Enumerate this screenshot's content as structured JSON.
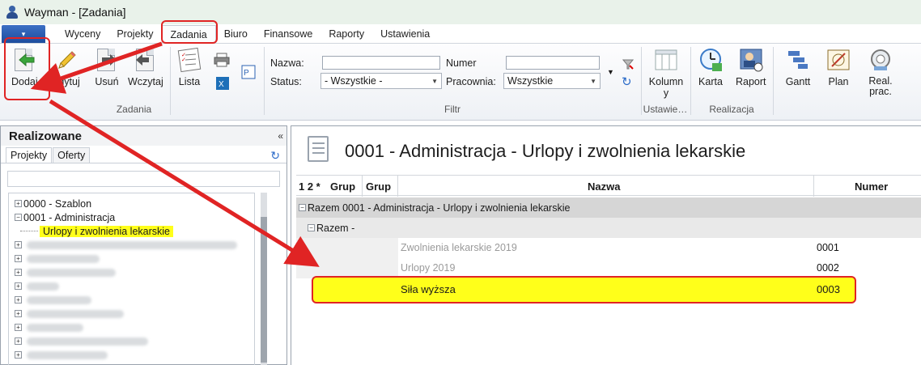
{
  "window": {
    "title": "Wayman - [Zadania]"
  },
  "menu": {
    "file_label": "▾",
    "tabs": [
      "Wyceny",
      "Projekty",
      "Zadania",
      "Biuro",
      "Finansowe",
      "Raporty",
      "Ustawienia"
    ],
    "active_tab": "Zadania"
  },
  "ribbon": {
    "zadania_group": {
      "label": "Zadania",
      "buttons": [
        "Dodaj",
        "Edytuj",
        "Usuń",
        "Wczytaj",
        "Lista"
      ]
    },
    "filtr_group": {
      "label": "Filtr",
      "nazwa_label": "Nazwa:",
      "nazwa_value": "",
      "numer_label": "Numer",
      "numer_value": "",
      "status_label": "Status:",
      "status_value": "- Wszystkie -",
      "pracownia_label": "Pracownia:",
      "pracownia_value": "Wszystkie"
    },
    "ustawienia_group": {
      "label": "Ustawie…",
      "button": "Kolumny"
    },
    "realizacja_group": {
      "label": "Realizacja",
      "buttons": [
        "Karta",
        "Raport"
      ]
    },
    "other_buttons": [
      "Gantt",
      "Plan",
      "Real. prac."
    ]
  },
  "left_panel": {
    "title": "Realizowane",
    "collapse": "«",
    "tabs": [
      "Projekty",
      "Oferty"
    ],
    "active_tab": "Projekty",
    "search_value": "",
    "tree": [
      {
        "toggle": "+",
        "label": "0000 - Szablon"
      },
      {
        "toggle": "−",
        "label": "0001 - Administracja"
      },
      {
        "toggle": "",
        "label": "Urlopy i zwolnienia lekarskie",
        "selected": true
      }
    ]
  },
  "right_panel": {
    "title": "0001 - Administracja - Urlopy i zwolnienia lekarskie",
    "columns": {
      "levels": "1 2 *",
      "grup1": "Grup",
      "grup2": "Grup",
      "nazwa": "Nazwa",
      "numer": "Numer"
    },
    "group_row": "Razem 0001 - Administracja - Urlopy i zwolnienia lekarskie",
    "subgroup_row": "Razem -",
    "rows": [
      {
        "name": "Zwolnienia lekarskie 2019",
        "number": "0001"
      },
      {
        "name": "Urlopy 2019",
        "number": "0002"
      },
      {
        "name": "Siła wyższa",
        "number": "0003"
      }
    ]
  },
  "colors": {
    "highlight": "#ffff1a",
    "annotation": "#e02424",
    "group_bg": "#d6d6d6"
  }
}
